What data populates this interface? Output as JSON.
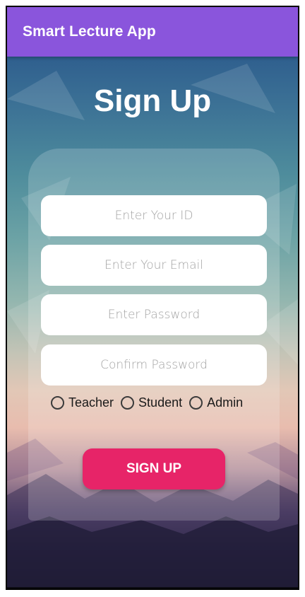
{
  "app_bar": {
    "title": "Smart Lecture App"
  },
  "page": {
    "title": "Sign Up"
  },
  "form": {
    "id_placeholder": "Enter Your ID",
    "email_placeholder": "Enter Your Email",
    "password_placeholder": "Enter Password",
    "confirm_placeholder": "Confirm Password",
    "roles": [
      {
        "label": "Teacher",
        "selected": false
      },
      {
        "label": "Student",
        "selected": false
      },
      {
        "label": "Admin",
        "selected": false
      }
    ],
    "submit_label": "SIGN UP"
  },
  "colors": {
    "app_bar": "#8a55dc",
    "button": "#e72468",
    "field": "#ffffff"
  }
}
